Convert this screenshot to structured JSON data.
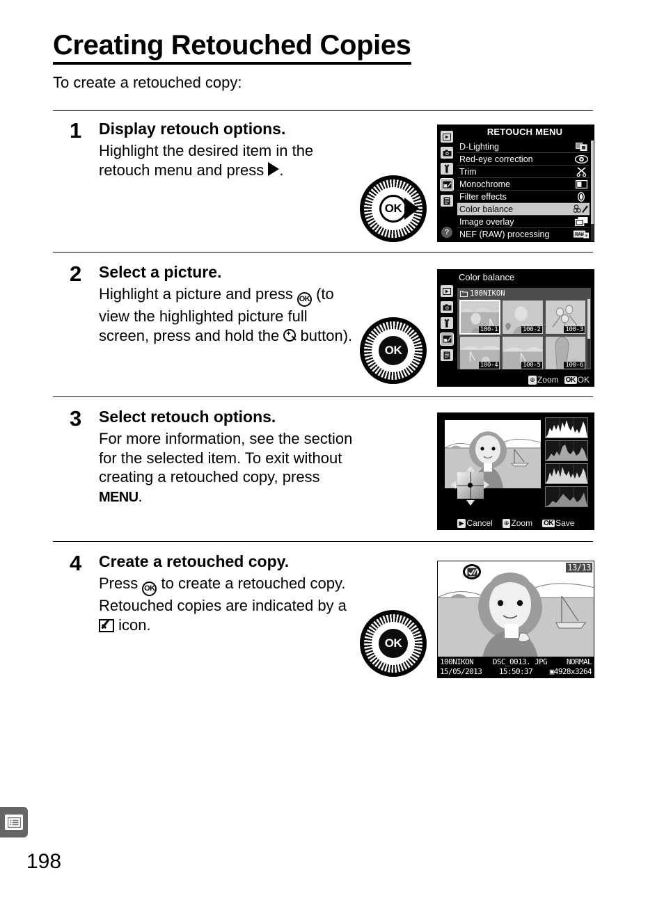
{
  "header": {
    "title": "Creating Retouched Copies",
    "intro": "To create a retouched copy:"
  },
  "steps": [
    {
      "number": "1",
      "heading": "Display retouch options.",
      "text_before": "Highlight the desired item in the retouch menu and press",
      "icon": "right-arrow-button",
      "text_after": "."
    },
    {
      "number": "2",
      "heading": "Select a picture.",
      "text_1": "Highlight a picture and press",
      "icon_1": "ok-button",
      "text_2": "(to view the highlighted picture full screen, press and hold the",
      "icon_2": "zoom-in-button",
      "text_3": "button)."
    },
    {
      "number": "3",
      "heading": "Select retouch options.",
      "text_1": "For more information, see the section for the selected item. To exit without creating a retouched copy, press",
      "icon_1": "menu-button",
      "menu_label": "MENU",
      "text_2": "."
    },
    {
      "number": "4",
      "heading": "Create a retouched copy.",
      "text_1": "Press",
      "icon_1": "ok-button",
      "text_2": "to create a retouched copy.  Retouched copies are indicated by a",
      "icon_2": "retouch-badge-icon",
      "text_3": "icon."
    }
  ],
  "screen_retouch_menu": {
    "title": "RETOUCH MENU",
    "sidebar_icons": [
      "playback-icon",
      "camera-icon",
      "wrench-icon",
      "retouch-icon",
      "recent-settings-icon"
    ],
    "help_label": "?",
    "items": [
      {
        "label": "D-Lighting",
        "icon": "d-lighting-icon",
        "highlighted": false
      },
      {
        "label": "Red-eye correction",
        "icon": "eye-icon",
        "highlighted": false
      },
      {
        "label": "Trim",
        "icon": "scissors-icon",
        "highlighted": false
      },
      {
        "label": "Monochrome",
        "icon": "monochrome-icon",
        "highlighted": false
      },
      {
        "label": "Filter effects",
        "icon": "filter-icon",
        "highlighted": false
      },
      {
        "label": "Color balance",
        "icon": "color-balance-icon",
        "highlighted": true
      },
      {
        "label": "Image overlay",
        "icon": "overlay-icon",
        "highlighted": false
      },
      {
        "label": "NEF (RAW) processing",
        "icon": "raw-icon",
        "highlighted": false
      }
    ]
  },
  "screen_picture_select": {
    "title": "Color balance",
    "folder": "100NIKON",
    "thumbnails": [
      {
        "label": "100-1",
        "selected": true
      },
      {
        "label": "100-2",
        "selected": false
      },
      {
        "label": "100-3",
        "selected": false
      },
      {
        "label": "100-4",
        "selected": false
      },
      {
        "label": "100-5",
        "selected": false
      },
      {
        "label": "100-6",
        "selected": false
      }
    ],
    "hints": [
      {
        "key": "zoom-icon",
        "label": "Zoom"
      },
      {
        "key": "OK",
        "label": "OK"
      }
    ]
  },
  "screen_edit": {
    "hints": [
      {
        "key": "playback-icon",
        "label": "Cancel"
      },
      {
        "key": "zoom-icon",
        "label": "Zoom"
      },
      {
        "key": "OK",
        "label": "Save"
      }
    ]
  },
  "screen_playback": {
    "badge": "retouch-badge-icon",
    "frame_counter": "13/13",
    "folder": "100NIKON",
    "filename": "DSC_0013. JPG",
    "quality": "NORMAL",
    "date": "15/05/2013",
    "time": "15:50:37",
    "size": "4928x3264"
  },
  "footer": {
    "tab_icon": "menu-guide-icon",
    "page_number": "198"
  }
}
